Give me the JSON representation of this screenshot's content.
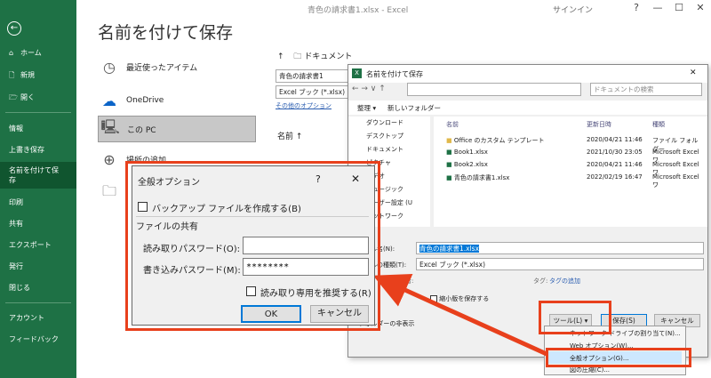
{
  "window": {
    "title": "青色の請求書1.xlsx  -  Excel",
    "signin": "サインイン",
    "controls": [
      "?",
      "—",
      "☐",
      "✕"
    ]
  },
  "sidebar": {
    "back_icon": "←",
    "items": [
      {
        "label": "ホーム",
        "icon": "⌂"
      },
      {
        "label": "新規",
        "icon": "🗋"
      },
      {
        "label": "開く",
        "icon": "🗁"
      },
      {
        "label": "情報",
        "icon": ""
      },
      {
        "label": "上書き保存",
        "icon": ""
      },
      {
        "label": "名前を付けて保存",
        "icon": ""
      },
      {
        "label": "印刷",
        "icon": ""
      },
      {
        "label": "共有",
        "icon": ""
      },
      {
        "label": "エクスポート",
        "icon": ""
      },
      {
        "label": "発行",
        "icon": ""
      },
      {
        "label": "閉じる",
        "icon": ""
      },
      {
        "label": "アカウント",
        "icon": ""
      },
      {
        "label": "フィードバック",
        "icon": ""
      }
    ]
  },
  "backstage": {
    "heading": "名前を付けて保存",
    "locations": [
      {
        "label": "最近使ったアイテム",
        "icon": "◷"
      },
      {
        "label": "OneDrive",
        "icon": "☁"
      },
      {
        "label": "この PC",
        "icon": "🖳"
      },
      {
        "label": "場所の追加",
        "icon": "⊕"
      },
      {
        "label": "",
        "icon": "🗀"
      }
    ],
    "up_icon": "↑",
    "path": "ドキュメント",
    "filename": "青色の請求書1",
    "filetype": "Excel ブック (*.xlsx)",
    "more_options": "その他のオプション",
    "name_col": "名前 ↑"
  },
  "save_dialog": {
    "title": "名前を付けて保存",
    "search_placeholder": "ドキュメントの検索",
    "organize": "整理 ▾",
    "new_folder": "新しいフォルダー",
    "nav": [
      "ダウンロード",
      "デスクトップ",
      "ドキュメント",
      "ピクチャ",
      "ビデオ",
      "ミュージック",
      "ユーザー設定 (U",
      "ネットワーク"
    ],
    "columns": [
      "名前",
      "更新日時",
      "種類"
    ],
    "files": [
      {
        "name": "Office のカスタム テンプレート",
        "date": "2020/04/21 11:46",
        "type": "ファイル フォルダー"
      },
      {
        "name": "Book1.xlsx",
        "date": "2021/10/30 23:05",
        "type": "Microsoft Excel ワ"
      },
      {
        "name": "Book2.xlsx",
        "date": "2020/04/21 11:46",
        "type": "Microsoft Excel ワ"
      },
      {
        "name": "青色の請求書1.xlsx",
        "date": "2022/02/19 16:47",
        "type": "Microsoft Excel ワ"
      }
    ],
    "filename_label": "ファイル名(N):",
    "filename_value": "青色の請求書1.xlsx",
    "filetype_label": "ファイルの種類(T):",
    "filetype_value": "Excel ブック (*.xlsx)",
    "author_label": "作成者:",
    "tag_label": "タグ:",
    "tag_value": "タグの追加",
    "thumbnail_label": "縮小版を保存する",
    "hide_folders": "フォルダーの非表示",
    "tools_button": "ツール(L)  ▾",
    "save_button": "保存(S)",
    "cancel_button": "キャンセル",
    "tools_menu": [
      "ネットワーク ドライブの割り当て(N)...",
      "Web オプション(W)...",
      "全般オプション(G)...",
      "図の圧縮(C)..."
    ]
  },
  "general_options": {
    "title": "全般オプション",
    "help": "?",
    "close": "✕",
    "backup_label": "バックアップ ファイルを作成する(B)",
    "sharing_group": "ファイルの共有",
    "read_pw_label": "読み取りパスワード(O):",
    "read_pw_value": "",
    "write_pw_label": "書き込みパスワード(M):",
    "write_pw_value": "********",
    "readonly_label": "読み取り専用を推奨する(R)",
    "ok": "OK",
    "cancel": "キャンセル"
  },
  "colors": {
    "excel_green": "#1e7145",
    "highlight_red": "#e8401c",
    "selection_blue": "#cde8ff"
  }
}
